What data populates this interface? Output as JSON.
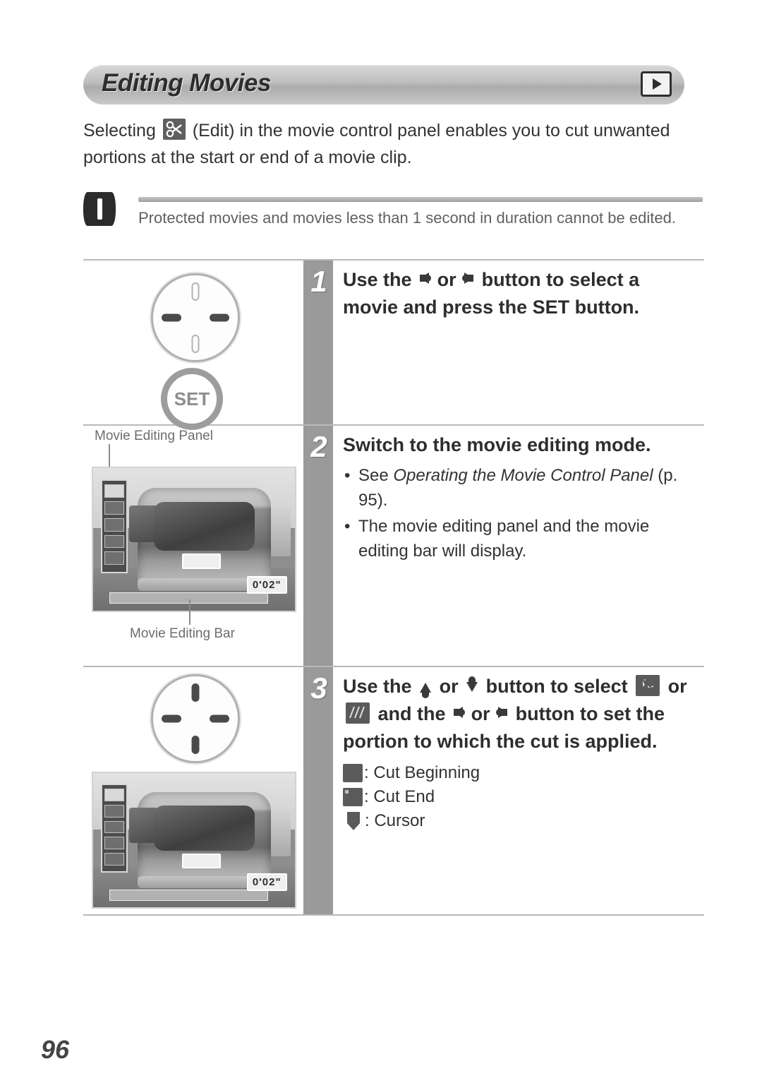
{
  "header": {
    "title": "Editing Movies",
    "mode_icon": "playback-icon"
  },
  "intro": {
    "before_icon": "Selecting",
    "icon": "scissors-edit-icon",
    "after_icon": "(Edit) in the movie control panel enables you to cut unwanted portions at the start or end of a movie clip."
  },
  "note": {
    "icon": "caution-exclamation-icon",
    "text": "Protected movies and movies less than 1 second in duration cannot be edited."
  },
  "steps": [
    {
      "number": "1",
      "heading_part1": "Use the",
      "heading_arrow1": "left-arrow-icon",
      "heading_part2": "or",
      "heading_arrow2": "right-arrow-icon",
      "heading_part3": "button to select a movie and press the SET button.",
      "visual": {
        "dial": {
          "up": "off",
          "down": "off",
          "left": "on",
          "right": "on"
        },
        "set_button_label": "SET"
      }
    },
    {
      "number": "2",
      "heading": "Switch to the movie editing mode.",
      "bullets": [
        {
          "pre": "See",
          "italic": "Operating the Movie Control Panel",
          "post": "(p. 95)."
        },
        {
          "pre": "",
          "italic": "",
          "post": "The movie editing panel and the movie editing bar will display."
        }
      ],
      "visual": {
        "callout_top": "Movie Editing Panel",
        "callout_bottom": "Movie Editing Bar",
        "timecode": "0'02\""
      }
    },
    {
      "number": "3",
      "heading_part1": "Use the",
      "heading_arrow1": "up-arrow-icon",
      "heading_part2": "or",
      "heading_arrow2": "down-arrow-icon",
      "heading_part3": "button to select",
      "heading_icon1": "cut-beginning-icon",
      "heading_part4": "or",
      "heading_icon2": "cut-end-icon",
      "heading_part5": "and the",
      "heading_arrow3": "left-arrow-icon",
      "heading_part6": "or",
      "heading_arrow4": "right-arrow-icon",
      "heading_part7": "button to set the portion to which the cut is applied.",
      "legend": [
        {
          "icon": "cut-beginning-icon",
          "label": ": Cut Beginning"
        },
        {
          "icon": "cut-end-icon",
          "label": ": Cut End"
        },
        {
          "icon": "cursor-icon",
          "label": ": Cursor"
        }
      ],
      "visual": {
        "dial": {
          "up": "on",
          "down": "on",
          "left": "on",
          "right": "on"
        },
        "timecode": "0'02\""
      }
    }
  ],
  "footer": {
    "page_number": "96"
  }
}
